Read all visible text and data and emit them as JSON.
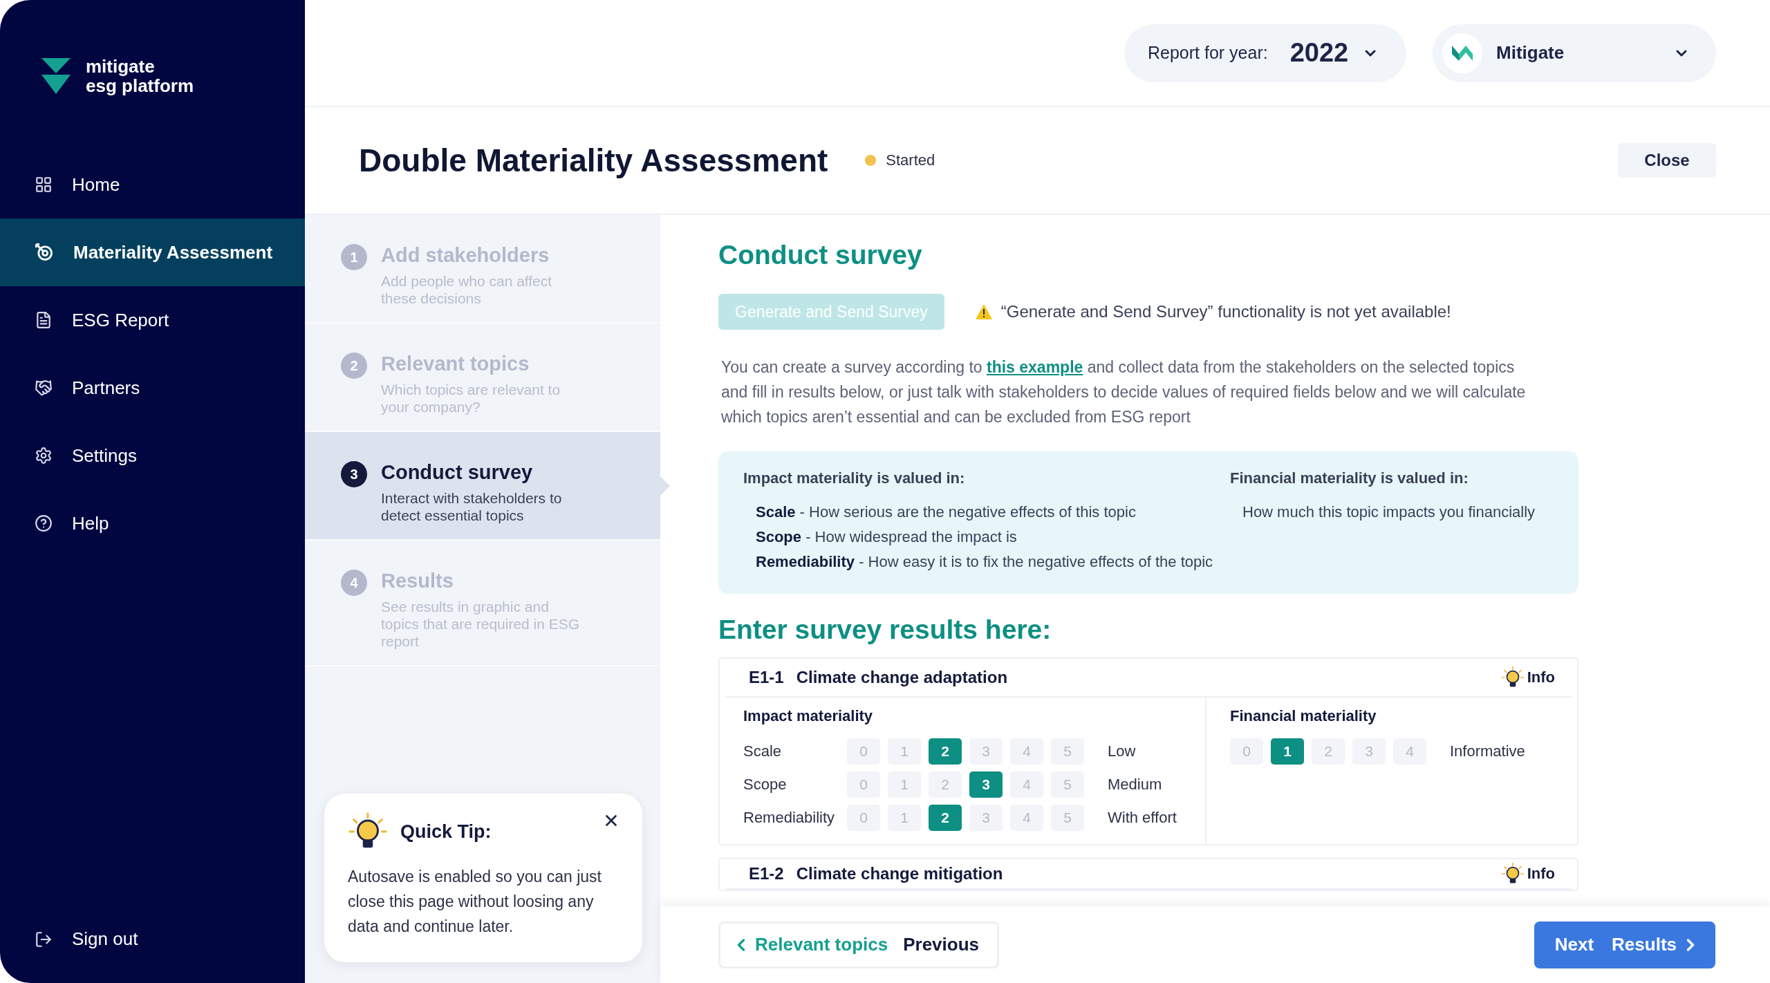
{
  "sidebar": {
    "logo": {
      "line1": "mitigate",
      "line2": "esg platform"
    },
    "items": [
      {
        "label": "Home",
        "selected": false
      },
      {
        "label": "Materiality Assessment",
        "selected": true
      },
      {
        "label": "ESG Report",
        "selected": false
      },
      {
        "label": "Partners",
        "selected": false
      },
      {
        "label": "Settings",
        "selected": false
      },
      {
        "label": "Help",
        "selected": false
      }
    ],
    "sign_out": "Sign out"
  },
  "header": {
    "year_label": "Report for year:",
    "year": "2022",
    "company": "Mitigate"
  },
  "page": {
    "title": "Double Materiality Assessment",
    "status": {
      "label": "Started",
      "color": "#f2c14e"
    },
    "close": "Close"
  },
  "steps": [
    {
      "number": "1",
      "title": "Add stakeholders",
      "description": "Add people who can affect these decisions",
      "selected": false
    },
    {
      "number": "2",
      "title": "Relevant topics",
      "description": "Which topics are relevant to your company?",
      "selected": false
    },
    {
      "number": "3",
      "title": "Conduct survey",
      "description": "Interact with stakeholders to detect essential topics",
      "selected": true
    },
    {
      "number": "4",
      "title": "Results",
      "description": "See results in graphic and topics that are required in ESG report",
      "selected": false
    }
  ],
  "quick_tip": {
    "title": "Quick Tip:",
    "text": "Autosave is enabled so you can just close this page without loosing any data and continue later."
  },
  "survey": {
    "heading": "Conduct survey",
    "generate_button": {
      "label": "Generate and Send Survey",
      "disabled": true
    },
    "warning": "“Generate and Send Survey” functionality is not yet available!",
    "intro": {
      "before": "You can create a survey according to ",
      "link": "this example",
      "after": " and collect data from the stakeholders on the selected topics and fill in results below, or just talk with stakeholders to decide values of required fields below and we will calculate which topics aren’t essential and can be excluded from ESG report"
    },
    "info": {
      "impact_heading": "Impact materiality is valued in:",
      "impact_items": [
        {
          "term": "Scale",
          "description": " - How serious are the negative effects of this topic"
        },
        {
          "term": "Scope",
          "description": " - How widespread the impact is"
        },
        {
          "term": "Remediability",
          "description": " - How easy it is to fix the negative effects of the topic"
        }
      ],
      "financial_heading": "Financial materiality is valued in:",
      "financial_text": "How much this topic impacts you financially"
    },
    "results_heading": "Enter survey results here:",
    "topics": [
      {
        "code": "E1-1",
        "title": "Climate change adaptation",
        "info_label": "Info",
        "impact_heading": "Impact materiality",
        "rows": [
          {
            "label": "Scale",
            "reading": "Low",
            "options": [
              {
                "label": "0",
                "selected": false
              },
              {
                "label": "1",
                "selected": false
              },
              {
                "label": "2",
                "selected": true
              },
              {
                "label": "3",
                "selected": false
              },
              {
                "label": "4",
                "selected": false
              },
              {
                "label": "5",
                "selected": false
              }
            ]
          },
          {
            "label": "Scope",
            "reading": "Medium",
            "options": [
              {
                "label": "0",
                "selected": false
              },
              {
                "label": "1",
                "selected": false
              },
              {
                "label": "2",
                "selected": false
              },
              {
                "label": "3",
                "selected": true
              },
              {
                "label": "4",
                "selected": false
              },
              {
                "label": "5",
                "selected": false
              }
            ]
          },
          {
            "label": "Remediability",
            "reading": "With effort",
            "options": [
              {
                "label": "0",
                "selected": false
              },
              {
                "label": "1",
                "selected": false
              },
              {
                "label": "2",
                "selected": true
              },
              {
                "label": "3",
                "selected": false
              },
              {
                "label": "4",
                "selected": false
              },
              {
                "label": "5",
                "selected": false
              }
            ]
          }
        ],
        "financial_heading": "Financial materiality",
        "financial": {
          "reading": "Informative",
          "options": [
            {
              "label": "0",
              "selected": false
            },
            {
              "label": "1",
              "selected": true
            },
            {
              "label": "2",
              "selected": false
            },
            {
              "label": "3",
              "selected": false
            },
            {
              "label": "4",
              "selected": false
            }
          ]
        }
      },
      {
        "code": "E1-2",
        "title": "Climate change mitigation",
        "info_label": "Info"
      }
    ]
  },
  "footer": {
    "previous": {
      "hint": "Relevant topics",
      "label": "Previous"
    },
    "next": {
      "label": "Next",
      "hint": "Results"
    }
  }
}
